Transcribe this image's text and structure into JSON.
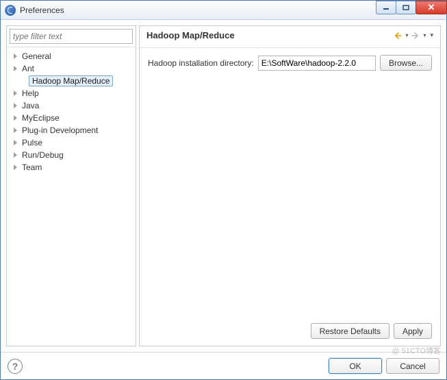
{
  "window": {
    "title": "Preferences"
  },
  "filter": {
    "placeholder": "type filter text"
  },
  "tree": {
    "items": [
      {
        "label": "General",
        "expandable": true
      },
      {
        "label": "Ant",
        "expandable": true
      },
      {
        "label": "Hadoop Map/Reduce",
        "expandable": false,
        "selected": true,
        "child": true
      },
      {
        "label": "Help",
        "expandable": true
      },
      {
        "label": "Java",
        "expandable": true
      },
      {
        "label": "MyEclipse",
        "expandable": true
      },
      {
        "label": "Plug-in Development",
        "expandable": true
      },
      {
        "label": "Pulse",
        "expandable": true
      },
      {
        "label": "Run/Debug",
        "expandable": true
      },
      {
        "label": "Team",
        "expandable": true
      }
    ]
  },
  "page": {
    "title": "Hadoop Map/Reduce",
    "field_label": "Hadoop installation directory:",
    "field_value": "E:\\SoftWare\\hadoop-2.2.0",
    "browse_label": "Browse...",
    "restore_label": "Restore Defaults",
    "apply_label": "Apply"
  },
  "footer": {
    "ok_label": "OK",
    "cancel_label": "Cancel"
  },
  "watermark": "@ 51CTO博客"
}
